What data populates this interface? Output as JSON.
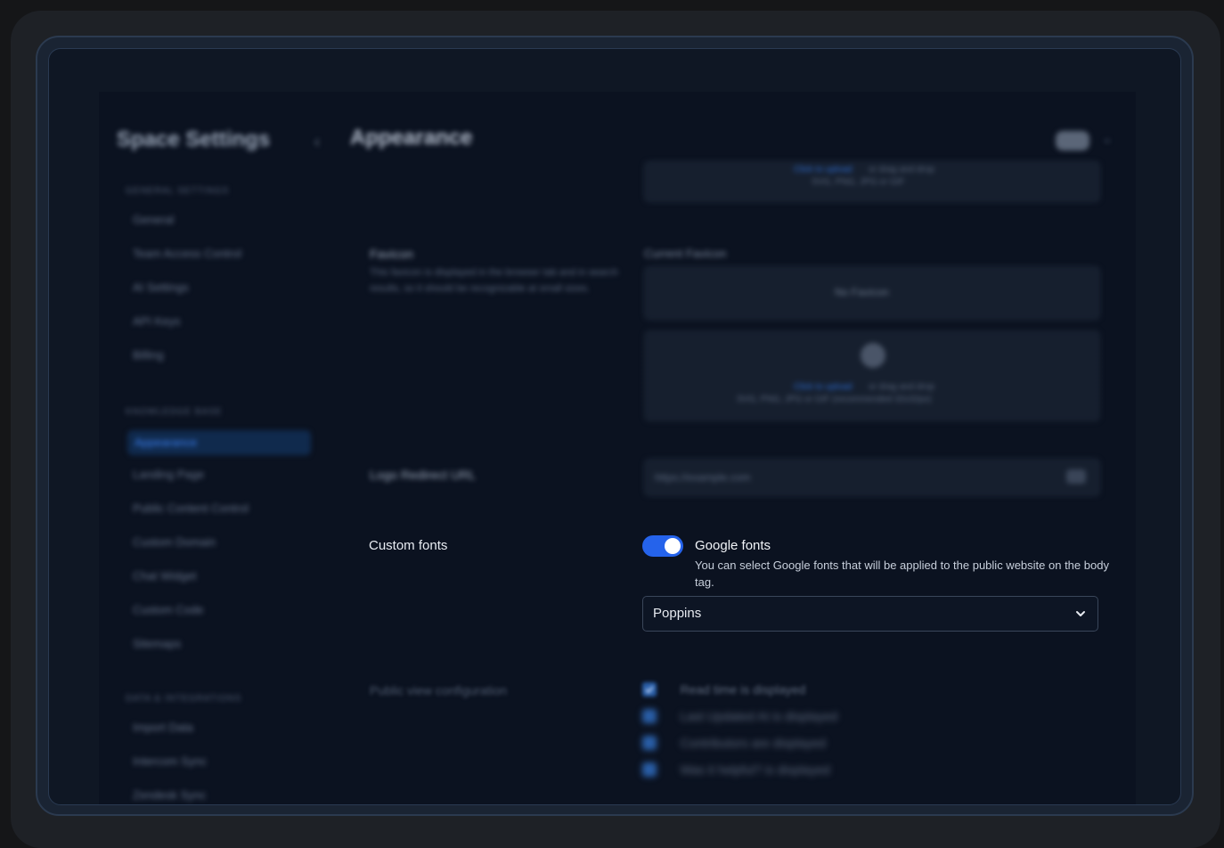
{
  "sidebar": {
    "title": "Space Settings",
    "collapse_icon": "chevron-left-icon",
    "sections": [
      {
        "label": "GENERAL SETTINGS",
        "items": [
          "General",
          "Team Access Control",
          "AI Settings",
          "API Keys",
          "Billing"
        ]
      },
      {
        "label": "KNOWLEDGE BASE",
        "items": [
          "Appearance",
          "Landing Page",
          "Public Content Control",
          "Custom Domain",
          "Chat Widget",
          "Custom Code",
          "Sitemaps"
        ]
      },
      {
        "label": "DATA & INTEGRATIONS",
        "items": [
          "Import Data",
          "Intercom Sync",
          "Zendesk Sync"
        ]
      }
    ],
    "active_item": "Appearance"
  },
  "header": {
    "title": "Appearance",
    "user_chip_icon": "avatar-icon"
  },
  "main": {
    "upload_top": {
      "link_text": "Click to upload",
      "rest_text": "or drag and drop",
      "hint": "SVG, PNG, JPG or GIF"
    },
    "favicon": {
      "label": "Favicon",
      "description": "This favicon is displayed in the browser tab and in search results, so it should be recognizable at small sizes.",
      "field_label": "Current Favicon",
      "current_value": "No Favicon",
      "upload_link": "Click to upload",
      "upload_rest": "or drag and drop",
      "upload_hint": "SVG, PNG, JPG or GIF (recommended 32x32px)"
    },
    "logo_url": {
      "label": "Logo Redirect URL",
      "placeholder": "https://example.com"
    },
    "custom_fonts": {
      "label": "Custom fonts",
      "toggle_on": true,
      "toggle_title": "Google fonts",
      "toggle_description": "You can select Google fonts that will be applied to the public website on the body tag.",
      "selected_font": "Poppins"
    },
    "public_view": {
      "label": "Public view configuration",
      "options": [
        {
          "text": "Read time is displayed",
          "checked": true
        },
        {
          "text": "Last Updated At is displayed",
          "checked": true
        },
        {
          "text": "Contributors are displayed",
          "checked": true
        },
        {
          "text": "Was it helpful? is displayed",
          "checked": true
        }
      ]
    }
  },
  "colors": {
    "accent": "#2563eb",
    "background": "#0b1220",
    "frame": "#1e2126"
  }
}
